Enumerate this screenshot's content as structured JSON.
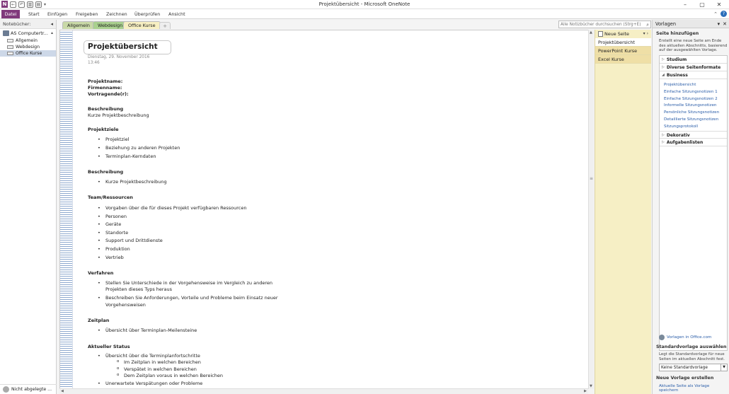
{
  "window": {
    "title": "Projektübersicht - Microsoft OneNote",
    "quick_access_more": "▾",
    "controls": [
      "–",
      "▢",
      "✕"
    ]
  },
  "ribbon": {
    "file": "Datei",
    "tabs": [
      "Start",
      "Einfügen",
      "Freigeben",
      "Zeichnen",
      "Überprüfen",
      "Ansicht"
    ],
    "help": "?"
  },
  "notebooks": {
    "header": "Notebücher:",
    "pin": "◂",
    "notebook": "AS Computertr...",
    "sections": [
      "Allgemein",
      "Webdesign",
      "Office Kurse"
    ],
    "selected_section": 2,
    "footer": "Nicht abgelegte ..."
  },
  "section_tabs": {
    "tabs": [
      {
        "label": "Allgemein",
        "color": "#c9d9a7"
      },
      {
        "label": "Webdesign",
        "color": "#a9d08e"
      },
      {
        "label": "Office Kurse",
        "color": "#f7efc2"
      }
    ],
    "add": "+"
  },
  "search": {
    "placeholder": "Alle Notizbücher durchsuchen (Strg+E)"
  },
  "page": {
    "title": "Projektübersicht",
    "date": "Dienstag, 29. November 2016",
    "time": "13:46",
    "fields": [
      "Projektname:",
      "Firmenname:",
      "Vortragende(r):"
    ],
    "desc_head": "Beschreibung",
    "desc_text": "Kurze Projektbeschreibung",
    "goals_head": "Projektziele",
    "goals": [
      "Projektziel",
      "Beziehung zu anderen Projekten",
      "Terminplan-Kerndaten"
    ],
    "desc2_head": "Beschreibung",
    "desc2_items": [
      "Kurze Projektbeschreibung"
    ],
    "team_head": "Team/Ressourcen",
    "team": [
      "Vorgaben über die für dieses Projekt verfügbaren Ressourcen",
      "Personen",
      "Geräte",
      "Standorte",
      "Support und Drittdienste",
      "Produktion",
      "Vertrieb"
    ],
    "proc_head": "Verfahren",
    "proc1a": "Stellen Sie Unterschiede in der Vorgehensweise im Vergleich zu anderen",
    "proc1b": "Projekten dieses Typs heraus",
    "proc2a": "Beschreiben Sie Anforderungen, Vorteile und Probleme beim Einsatz neuer",
    "proc2b": "Vorgehensweisen",
    "time_head": "Zeitplan",
    "time_items": [
      "Übersicht über Terminplan-Meilensteine"
    ],
    "status_head": "Aktueller Status",
    "status1": "Übersicht über die Terminplanfortschritte",
    "status_sub": [
      "Im Zeitplan in welchen Bereichen",
      "Verspätet in welchen Bereichen",
      "Dem Zeitplan voraus in welchen Bereichen"
    ],
    "status2": "Unerwartete Verspätungen oder Probleme"
  },
  "pages_list": {
    "new_page": "Neue Seite",
    "arrows": "▾ ›",
    "pages": [
      "Projektübersicht",
      "PowerPoint Kurse",
      "Excel Kurse"
    ],
    "selected": 0
  },
  "templates": {
    "header": "Vorlagen",
    "add_page": "Seite hinzufügen",
    "add_desc": "Erstellt eine neue Seite am Ende des aktuellen Abschnitts, basierend auf der ausgewählten Vorlage.",
    "categories": [
      "Studium",
      "Diverse Seitenformate",
      "Business"
    ],
    "business": [
      "Projektübersicht",
      "Einfache Sitzungsnotizen 1",
      "Einfache Sitzungsnotizen 2",
      "Informelle Sitzungsnotizen",
      "Persönliche Sitzungsnotizen",
      "Detaillierte Sitzungsnotizen",
      "Sitzungsprotokoll"
    ],
    "more_categories": [
      "Dekorativ",
      "Aufgabenlisten"
    ],
    "office_link": "Vorlagen in Office.com",
    "default_head": "Standardvorlage auswählen",
    "default_desc": "Legt die Standardvorlage für neue Seiten im aktuellen Abschnitt fest.",
    "default_value": "Keine Standardvorlage",
    "new_head": "Neue Vorlage erstellen",
    "new_link": "Aktuelle Seite als Vorlage speichern"
  }
}
